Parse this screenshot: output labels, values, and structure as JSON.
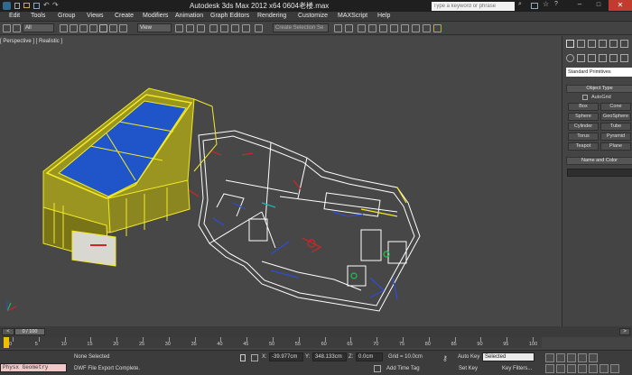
{
  "app": {
    "title": "Autodesk 3ds Max  2012 x64      0604老楼.max",
    "search_placeholder": "Type a keyword or phrase"
  },
  "menu": [
    "Edit",
    "Tools",
    "Group",
    "Views",
    "Create",
    "Modifiers",
    "Animation",
    "Graph Editors",
    "Rendering",
    "Customize",
    "MAXScript",
    "Help"
  ],
  "toolbar": {
    "selection_filter": "All",
    "ref_coord": "View",
    "named_selection": "Create Selection Se"
  },
  "viewport": {
    "label": "[ Perspective ] [ Realistic ]",
    "colors": {
      "background": "#474747",
      "wire": "#f2ea26",
      "roof": "#1f55c8",
      "floorplan": "#ffffff"
    }
  },
  "command_panel": {
    "category": "Standard Primitives",
    "object_type_header": "Object Type",
    "autogrid_label": "AutoGrid",
    "buttons": [
      "Box",
      "Cone",
      "Sphere",
      "GeoSphere",
      "Cylinder",
      "Tube",
      "Torus",
      "Pyramid",
      "Teapot",
      "Plane"
    ],
    "name_color_header": "Name and Color"
  },
  "timeline": {
    "frame_display": "0 / 100",
    "ruler_ticks": [
      "0",
      "5",
      "10",
      "15",
      "20",
      "25",
      "30",
      "35",
      "40",
      "45",
      "50",
      "55",
      "60",
      "65",
      "70",
      "75",
      "80",
      "85",
      "90",
      "95",
      "100"
    ]
  },
  "status": {
    "selection": "None Selected",
    "prompt": "DWF File Export Complete.",
    "script_listener": "Physx Geometry",
    "x_label": "X:",
    "x_value": "-39.977cm",
    "y_label": "Y:",
    "y_value": "348.133cm",
    "z_label": "Z:",
    "z_value": "0.0cm",
    "grid": "Grid = 10.0cm",
    "add_time_tag": "Add Time Tag",
    "auto_key": "Auto Key",
    "auto_key_mode": "Selected",
    "set_key": "Set Key",
    "key_filters": "Key Filters..."
  }
}
